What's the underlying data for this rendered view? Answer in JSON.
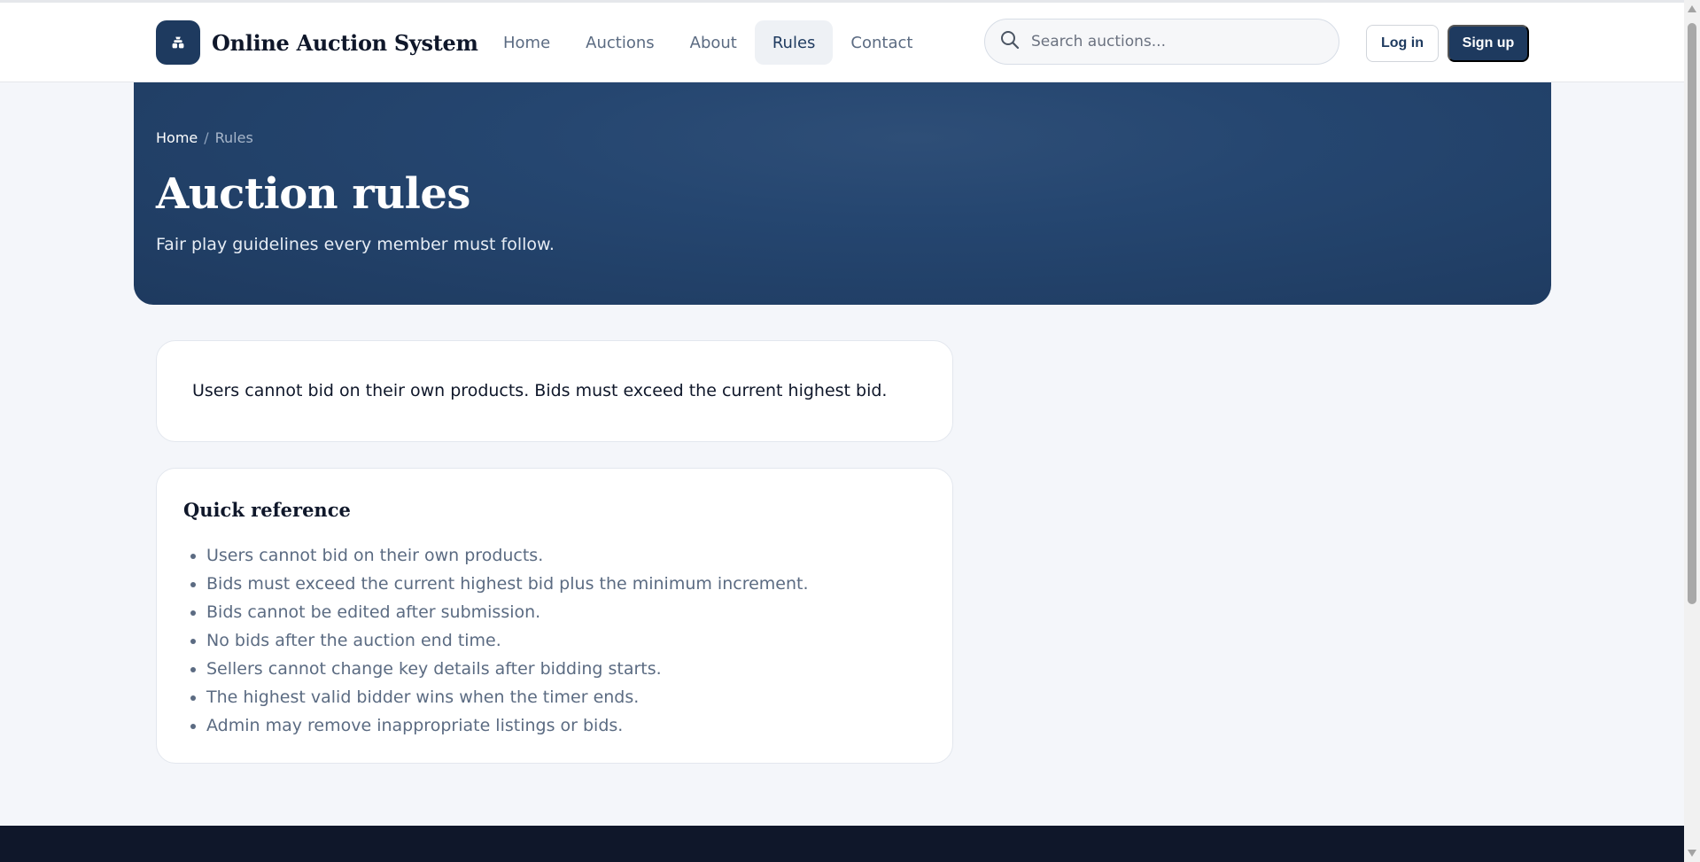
{
  "header": {
    "brand_name": "Online Auction System",
    "brand_icon": "gavel-icon",
    "nav": [
      {
        "label": "Home",
        "active": false
      },
      {
        "label": "Auctions",
        "active": false
      },
      {
        "label": "About",
        "active": false
      },
      {
        "label": "Rules",
        "active": true
      },
      {
        "label": "Contact",
        "active": false
      }
    ],
    "search": {
      "placeholder": "Search auctions...",
      "value": ""
    },
    "login_label": "Log in",
    "signup_label": "Sign up"
  },
  "hero": {
    "breadcrumb": {
      "home": "Home",
      "separator": "/",
      "current": "Rules"
    },
    "title": "Auction rules",
    "subtitle": "Fair play guidelines every member must follow."
  },
  "main": {
    "rules_summary": "Users cannot bid on their own products. Bids must exceed the current highest bid.",
    "quick_reference": {
      "title": "Quick reference",
      "items": [
        "Users cannot bid on their own products.",
        "Bids must exceed the current highest bid plus the minimum increment.",
        "Bids cannot be edited after submission.",
        "No bids after the auction end time.",
        "Sellers cannot change key details after bidding starts.",
        "The highest valid bidder wins when the timer ends.",
        "Admin may remove inappropriate listings or bids."
      ]
    }
  },
  "colors": {
    "primary": "#1e3a5f",
    "background": "#f4f6fa",
    "footer": "#0f172a",
    "muted_text": "#5b6b82"
  }
}
